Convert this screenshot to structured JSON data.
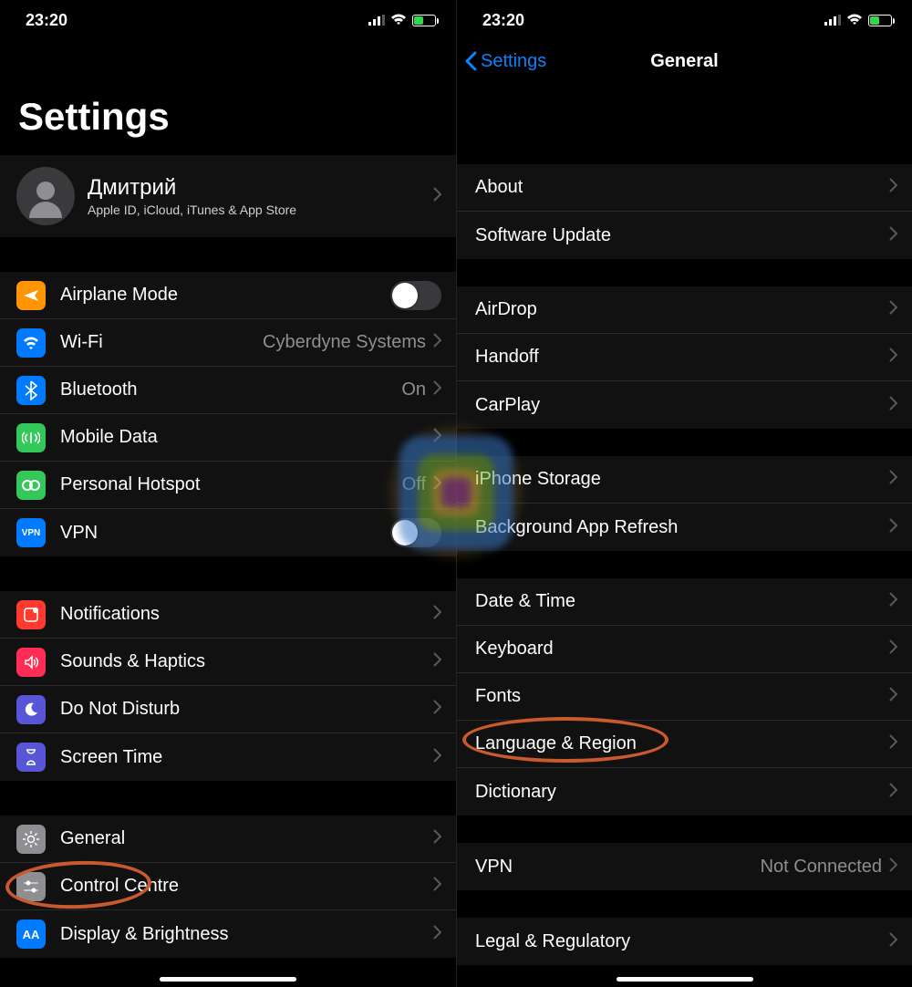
{
  "status": {
    "time": "23:20"
  },
  "left": {
    "title": "Settings",
    "profile": {
      "name": "Дмитрий",
      "sub": "Apple ID, iCloud, iTunes & App Store"
    },
    "g1": {
      "airplane": "Airplane Mode",
      "wifi": "Wi-Fi",
      "wifi_val": "Cyberdyne Systems",
      "bt": "Bluetooth",
      "bt_val": "On",
      "mobile": "Mobile Data",
      "hotspot": "Personal Hotspot",
      "hotspot_val": "Off",
      "vpn": "VPN"
    },
    "g2": {
      "notifications": "Notifications",
      "sounds": "Sounds & Haptics",
      "dnd": "Do Not Disturb",
      "screentime": "Screen Time"
    },
    "g3": {
      "general": "General",
      "control": "Control Centre",
      "display": "Display & Brightness"
    }
  },
  "right": {
    "back": "Settings",
    "title": "General",
    "g1": {
      "about": "About",
      "software": "Software Update"
    },
    "g2": {
      "airdrop": "AirDrop",
      "handoff": "Handoff",
      "carplay": "CarPlay"
    },
    "g3": {
      "storage": "iPhone Storage",
      "bgrefresh": "Background App Refresh"
    },
    "g4": {
      "date": "Date & Time",
      "keyboard": "Keyboard",
      "fonts": "Fonts",
      "lang": "Language & Region",
      "dict": "Dictionary"
    },
    "g5": {
      "vpn": "VPN",
      "vpn_val": "Not Connected"
    },
    "g6": {
      "legal": "Legal & Regulatory"
    }
  }
}
